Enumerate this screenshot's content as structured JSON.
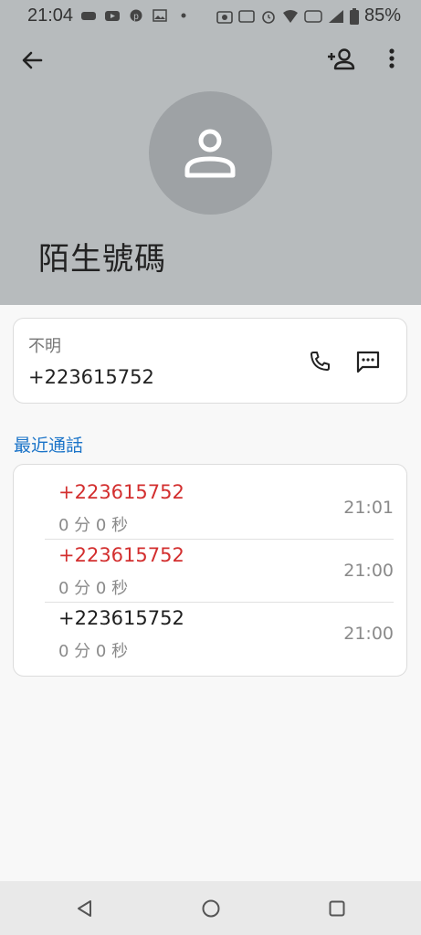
{
  "status_bar": {
    "time": "21:04",
    "battery": "85%"
  },
  "header": {
    "contact_name": "陌生號碼",
    "back_icon": "arrow-left-icon",
    "add_contact_icon": "person-add-icon",
    "more_icon": "more-vert-icon",
    "background_color": "#b7bbbd"
  },
  "number_card": {
    "type_label": "不明",
    "number": "+223615752",
    "call_icon": "phone-icon",
    "message_icon": "message-icon"
  },
  "recent_calls": {
    "title": "最近通話",
    "items": [
      {
        "number": "+223615752",
        "duration": "0 分 0 秒",
        "time": "21:01",
        "missed": true
      },
      {
        "number": "+223615752",
        "duration": "0 分 0 秒",
        "time": "21:00",
        "missed": true
      },
      {
        "number": "+223615752",
        "duration": "0 分 0 秒",
        "time": "21:00",
        "missed": false
      }
    ]
  },
  "colors": {
    "accent": "#1a73c8",
    "missed": "#d32f2f"
  }
}
